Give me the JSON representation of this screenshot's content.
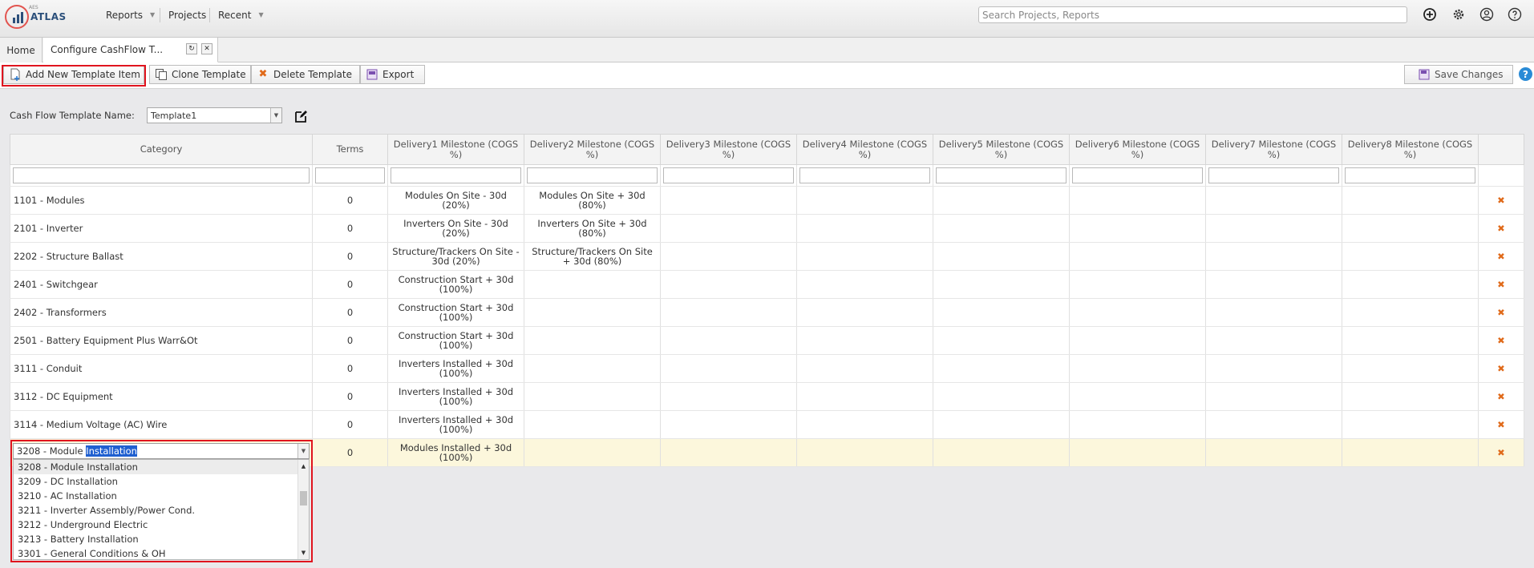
{
  "app": {
    "logo_small": "AES",
    "logo_name": "ATLAS",
    "nav": {
      "reports": "Reports",
      "projects": "Projects",
      "recent": "Recent"
    },
    "search_placeholder": "Search Projects, Reports"
  },
  "tabs": {
    "home": "Home",
    "active": "Configure CashFlow T..."
  },
  "toolbar": {
    "add": "Add New Template Item",
    "clone": "Clone Template",
    "delete": "Delete Template",
    "export": "Export",
    "save": "Save Changes"
  },
  "form": {
    "label": "Cash Flow Template Name:",
    "value": "Template1"
  },
  "grid": {
    "headers": [
      "Category",
      "Terms",
      "Delivery1 Milestone (COGS %)",
      "Delivery2 Milestone (COGS %)",
      "Delivery3 Milestone (COGS %)",
      "Delivery4 Milestone (COGS %)",
      "Delivery5 Milestone (COGS %)",
      "Delivery6 Milestone (COGS %)",
      "Delivery7 Milestone (COGS %)",
      "Delivery8 Milestone (COGS %)"
    ],
    "rows": [
      {
        "category": "1101 - Modules",
        "terms": "0",
        "d1": "Modules On Site - 30d (20%)",
        "d2": "Modules On Site + 30d (80%)"
      },
      {
        "category": "2101 - Inverter",
        "terms": "0",
        "d1": "Inverters On Site - 30d (20%)",
        "d2": "Inverters On Site + 30d (80%)"
      },
      {
        "category": "2202 - Structure Ballast",
        "terms": "0",
        "d1": "Structure/Trackers On Site - 30d (20%)",
        "d2": "Structure/Trackers On Site + 30d (80%)"
      },
      {
        "category": "2401 - Switchgear",
        "terms": "0",
        "d1": "Construction Start + 30d (100%)",
        "d2": ""
      },
      {
        "category": "2402 - Transformers",
        "terms": "0",
        "d1": "Construction Start + 30d (100%)",
        "d2": ""
      },
      {
        "category": "2501 - Battery Equipment Plus Warr&Ot",
        "terms": "0",
        "d1": "Construction Start + 30d (100%)",
        "d2": ""
      },
      {
        "category": "3111 - Conduit",
        "terms": "0",
        "d1": "Inverters Installed + 30d (100%)",
        "d2": ""
      },
      {
        "category": "3112 - DC Equipment",
        "terms": "0",
        "d1": "Inverters Installed + 30d (100%)",
        "d2": ""
      },
      {
        "category": "3114 - Medium Voltage (AC) Wire",
        "terms": "0",
        "d1": "Inverters Installed + 30d (100%)",
        "d2": ""
      },
      {
        "category": "",
        "terms": "0",
        "d1": "Modules Installed + 30d (100%)",
        "d2": ""
      }
    ],
    "delete_glyph": "✖"
  },
  "dropdown": {
    "input_prefix": "3208 - Module ",
    "input_selected": "Installation",
    "options": [
      "3208 - Module Installation",
      "3209 - DC Installation",
      "3210 - AC Installation",
      "3211 - Inverter Assembly/Power Cond.",
      "3212 - Underground Electric",
      "3213 - Battery Installation",
      "3301 - General Conditions & OH"
    ]
  },
  "colors": {
    "highlight": "#e0141e",
    "help": "#2a8bd6",
    "delete": "#e06a1a",
    "selected_row": "#fcf7dc",
    "text_selection": "#1f5fd0"
  }
}
